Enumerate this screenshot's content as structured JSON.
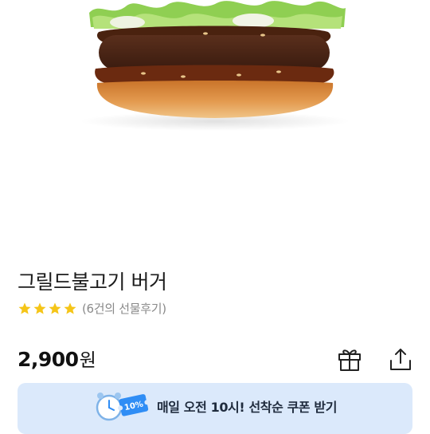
{
  "product": {
    "title": "그릴드불고기 버거",
    "rating_stars": 4,
    "review_text": "(6건의 선물후기)",
    "price_value": "2,900",
    "price_unit": "원"
  },
  "actions": {
    "gift_icon": "gift-icon",
    "share_icon": "share-icon"
  },
  "coupon_banner": {
    "text": "매일 오전 10시! 선착순 쿠폰 받기",
    "icon": "alarm-clock-coupon-icon",
    "badge_text": "10%"
  },
  "colors": {
    "star": "#f5c518",
    "banner_bg": "#dbe9fb",
    "coupon_accent": "#2f8df5"
  }
}
